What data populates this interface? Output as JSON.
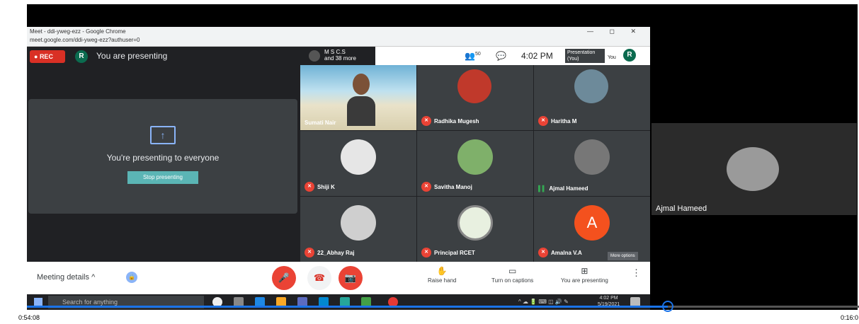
{
  "browser": {
    "title": "Meet - ddi-yweg-ezz - Google Chrome",
    "url": "meet.google.com/ddi-yweg-ezz?authuser=0",
    "window_controls": "— ◻ ✕"
  },
  "meet": {
    "rec_label": "REC",
    "user_initial": "R",
    "presenting_label": "You are presenting",
    "meeting_info": "M S C.S",
    "more_count": "and 38 more",
    "people_count": "50",
    "clock": "4:02 PM",
    "presentation_you": "Presentation (You)",
    "you_label": "You",
    "present_card": {
      "text": "You're presenting to everyone",
      "button": "Stop presenting"
    },
    "tiles": [
      {
        "name": "Sumati Nair",
        "mic": "off",
        "kind": "video"
      },
      {
        "name": "Radhika Mugesh",
        "mic": "off",
        "kind": "avatar",
        "color": "#c0392b"
      },
      {
        "name": "Haritha M",
        "mic": "off",
        "kind": "avatar",
        "color": "#6d8a9a"
      },
      {
        "name": "Shiji K",
        "mic": "off",
        "kind": "avatar",
        "color": "#e6e6e6"
      },
      {
        "name": "Savitha Manoj",
        "mic": "off",
        "kind": "avatar",
        "color": "#7fb06a"
      },
      {
        "name": "Ajmal Hameed",
        "mic": "on",
        "kind": "avatar",
        "color": "#777777"
      },
      {
        "name": "22_Abhay Raj",
        "mic": "off",
        "kind": "avatar",
        "color": "#cfcfcf"
      },
      {
        "name": "Principal RCET",
        "mic": "off",
        "kind": "avatar",
        "color": "#e8f0e0"
      },
      {
        "name": "Amalna V.A",
        "mic": "off",
        "kind": "letter",
        "letter": "A"
      }
    ],
    "more_options_tooltip": "More options",
    "bottom": {
      "meeting_details": "Meeting details",
      "raise_hand": "Raise hand",
      "captions": "Turn on captions",
      "you_presenting": "You are presenting"
    }
  },
  "taskbar": {
    "search_placeholder": "Search for anything",
    "time": "4:02 PM",
    "date": "5/19/2021"
  },
  "side_tile": {
    "name": "Ajmal Hameed"
  },
  "player": {
    "elapsed": "0:54:08",
    "duration": "0:16:0",
    "progress_fraction": 0.77
  }
}
